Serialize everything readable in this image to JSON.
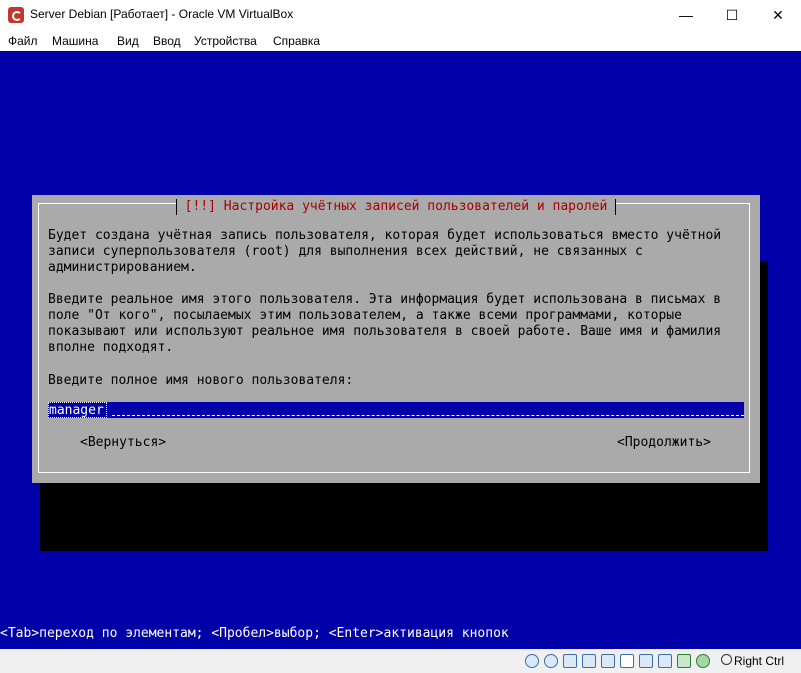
{
  "window": {
    "title": "Server Debian [Работает] - Oracle VM VirtualBox",
    "icons": {
      "app": "virtualbox-icon",
      "minimize": "minimize-icon",
      "maximize": "maximize-icon",
      "close": "close-icon"
    },
    "minimize_glyph": "—",
    "maximize_glyph": "☐",
    "close_glyph": "✕"
  },
  "menu": [
    "Файл",
    "Машина",
    "Вид",
    "Ввод",
    "Устройства",
    "Справка"
  ],
  "dialog": {
    "title": "[!!] Настройка учётных записей пользователей и паролей",
    "para1": "Будет создана учётная запись пользователя, которая будет использоваться вместо учётной\nзаписи суперпользователя (root) для выполнения всех действий, не связанных с\nадминистрированием.",
    "para2": "Введите реальное имя этого пользователя. Эта информация будет использована в письмах в\nполе \"От кого\", посылаемых этим пользователем, а также всеми программами, которые\nпоказывают или используют реальное имя пользователя в своей работе. Ваше имя и фамилия\nвполне подходят.",
    "prompt": "Введите полное имя нового пользователя:",
    "input_value": "manager",
    "back_button": "<Вернуться>",
    "continue_button": "<Продолжить>",
    "colors": {
      "screen_bg": "#0000a8",
      "dialog_bg": "#aaaaaa",
      "title_fg": "#a80000"
    }
  },
  "help_line": "<Tab>переход по элементам; <Пробел>выбор; <Enter>активация кнопок",
  "statusbar": {
    "icons": [
      "hard-disk-icon",
      "optical-drive-icon",
      "audio-icon",
      "network-icon",
      "usb-icon",
      "shared-folders-icon",
      "display-icon",
      "video-capture-icon",
      "recording-icon",
      "cpu-icon",
      "mouse-integration-icon"
    ],
    "host_key": "Right Ctrl"
  }
}
